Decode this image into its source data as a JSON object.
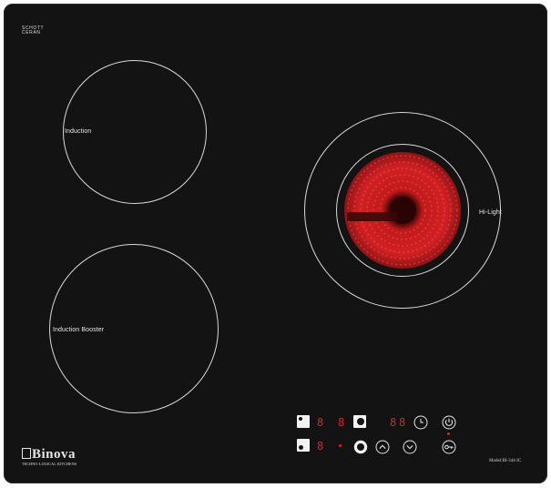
{
  "brand": {
    "maker_line1": "SCHOTT",
    "maker_line2": "CERAN",
    "logo": "Binova",
    "tagline": "TECHNO-LOGICAL KITCHENS",
    "model": "Model:BI-344-IC"
  },
  "zones": {
    "top_left": {
      "label": "Induction"
    },
    "bottom_left": {
      "label": "Induction Booster"
    },
    "right": {
      "label": "Hi-Light",
      "state": "heating"
    }
  },
  "controls": {
    "display_zone_top_a": "8",
    "display_zone_top_b": "8",
    "display_timer_a": "8",
    "display_timer_b": "8",
    "display_zone_bottom": "8",
    "icons": [
      "zone-select-top-left-icon",
      "zone-select-top-right-icon",
      "timer-clock-icon",
      "power-icon",
      "zone-select-bottom-left-icon",
      "zone-select-bottom-right-icon",
      "plus-icon",
      "minus-icon",
      "lock-key-icon"
    ]
  },
  "colors": {
    "glass": "#131313",
    "display": "#e0221e",
    "lines": "#d9d9d9",
    "heater": "#c7191b"
  }
}
